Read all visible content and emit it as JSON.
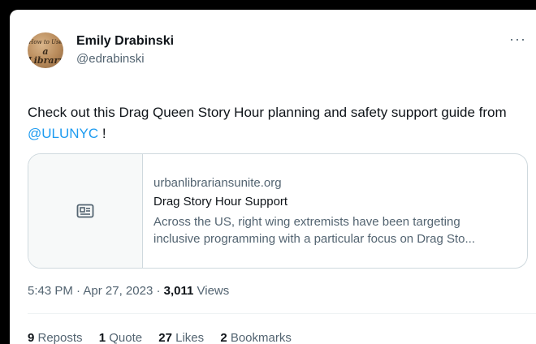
{
  "author": {
    "display_name": "Emily Drabinski",
    "handle": "@edrabinski",
    "avatar_text_line1": "How to Use",
    "avatar_text_line2": "a Library"
  },
  "more_icon": "more-horizontal-icon",
  "tweet": {
    "text_before": "Check out this Drag Queen Story Hour planning and safety support guide from ",
    "mention": "@ULUNYC",
    "text_after": " !"
  },
  "link_card": {
    "icon": "news-article-icon",
    "domain": "urbanlibrariansunite.org",
    "title": "Drag Story Hour Support",
    "description_line1": "Across the US, right wing extremists have been targeting",
    "description_line2": "inclusive programming with a particular focus on Drag Sto..."
  },
  "meta": {
    "time": "5:43 PM",
    "separator1": " · ",
    "date": "Apr 27, 2023",
    "separator2": " · ",
    "views_count": "3,011",
    "views_label": " Views"
  },
  "stats": {
    "reposts_count": "9",
    "reposts_label": " Reposts",
    "quotes_count": "1",
    "quotes_label": " Quote",
    "likes_count": "27",
    "likes_label": " Likes",
    "bookmarks_count": "2",
    "bookmarks_label": " Bookmarks"
  },
  "colors": {
    "link_blue": "#1d9bf0",
    "text_primary": "#0f1419",
    "text_secondary": "#536471",
    "border": "#cfd9de"
  }
}
